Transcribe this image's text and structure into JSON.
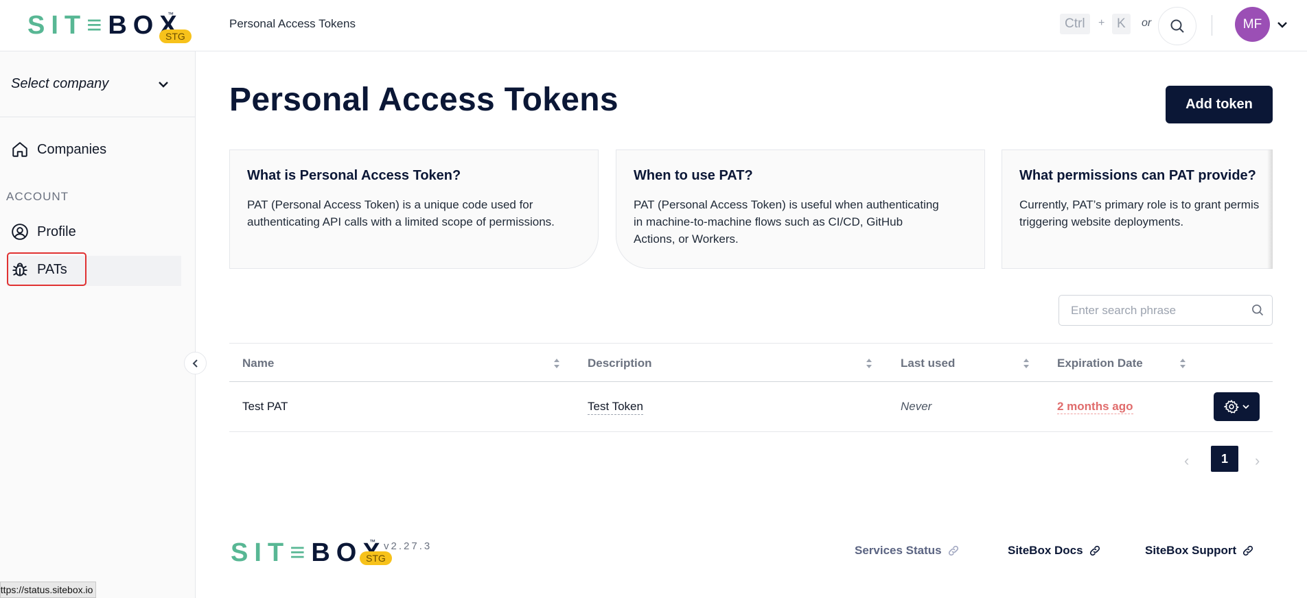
{
  "header": {
    "logo_site": "SIT",
    "logo_e": "≡",
    "logo_box": "BOX",
    "logo_tm": "™",
    "logo_badge": "STG",
    "breadcrumb": "Personal Access Tokens",
    "shortcut_ctrl": "Ctrl",
    "shortcut_plus": "+",
    "shortcut_k": "K",
    "shortcut_or": "or",
    "avatar_initials": "MF",
    "avatar_color": "#9b4fb5"
  },
  "sidebar": {
    "company_select": "Select company",
    "companies_label": "Companies",
    "section_account": "ACCOUNT",
    "profile_label": "Profile",
    "pats_label": "PATs"
  },
  "main": {
    "title": "Personal Access Tokens",
    "add_token_label": "Add token",
    "cards": [
      {
        "title": "What is Personal Access Token?",
        "line1": "PAT (Personal Access Token) is a unique code used for",
        "line2": "authenticating API calls with a limited scope of permissions.",
        "line3": ""
      },
      {
        "title": "When to use PAT?",
        "line1": "PAT (Personal Access Token) is useful when authenticating",
        "line2": "in machine-to-machine flows such as CI/CD, GitHub",
        "line3": "Actions, or Workers."
      },
      {
        "title": "What permissions can PAT provide?",
        "line1": "Currently, PAT’s primary role is to grant permis",
        "line2": "triggering website deployments.",
        "line3": ""
      }
    ],
    "search_placeholder": "Enter search phrase",
    "table": {
      "columns": [
        "Name",
        "Description",
        "Last used",
        "Expiration Date"
      ],
      "rows": [
        {
          "name": "Test PAT",
          "description": "Test Token",
          "last_used": "Never",
          "expiration": "2 months ago"
        }
      ]
    },
    "pagination": {
      "prev": "‹",
      "current": "1",
      "next": "›"
    }
  },
  "footer": {
    "version": "v2.27.3",
    "links": [
      "Services Status",
      "SiteBox Docs",
      "SiteBox Support"
    ]
  },
  "status_bar_url": "https://status.sitebox.io",
  "colors": {
    "brand_navy": "#0b1736",
    "brand_green": "#58b794",
    "badge_yellow": "#f7c21b",
    "expired_red": "#e06c6c",
    "highlight_red": "#e03131"
  }
}
